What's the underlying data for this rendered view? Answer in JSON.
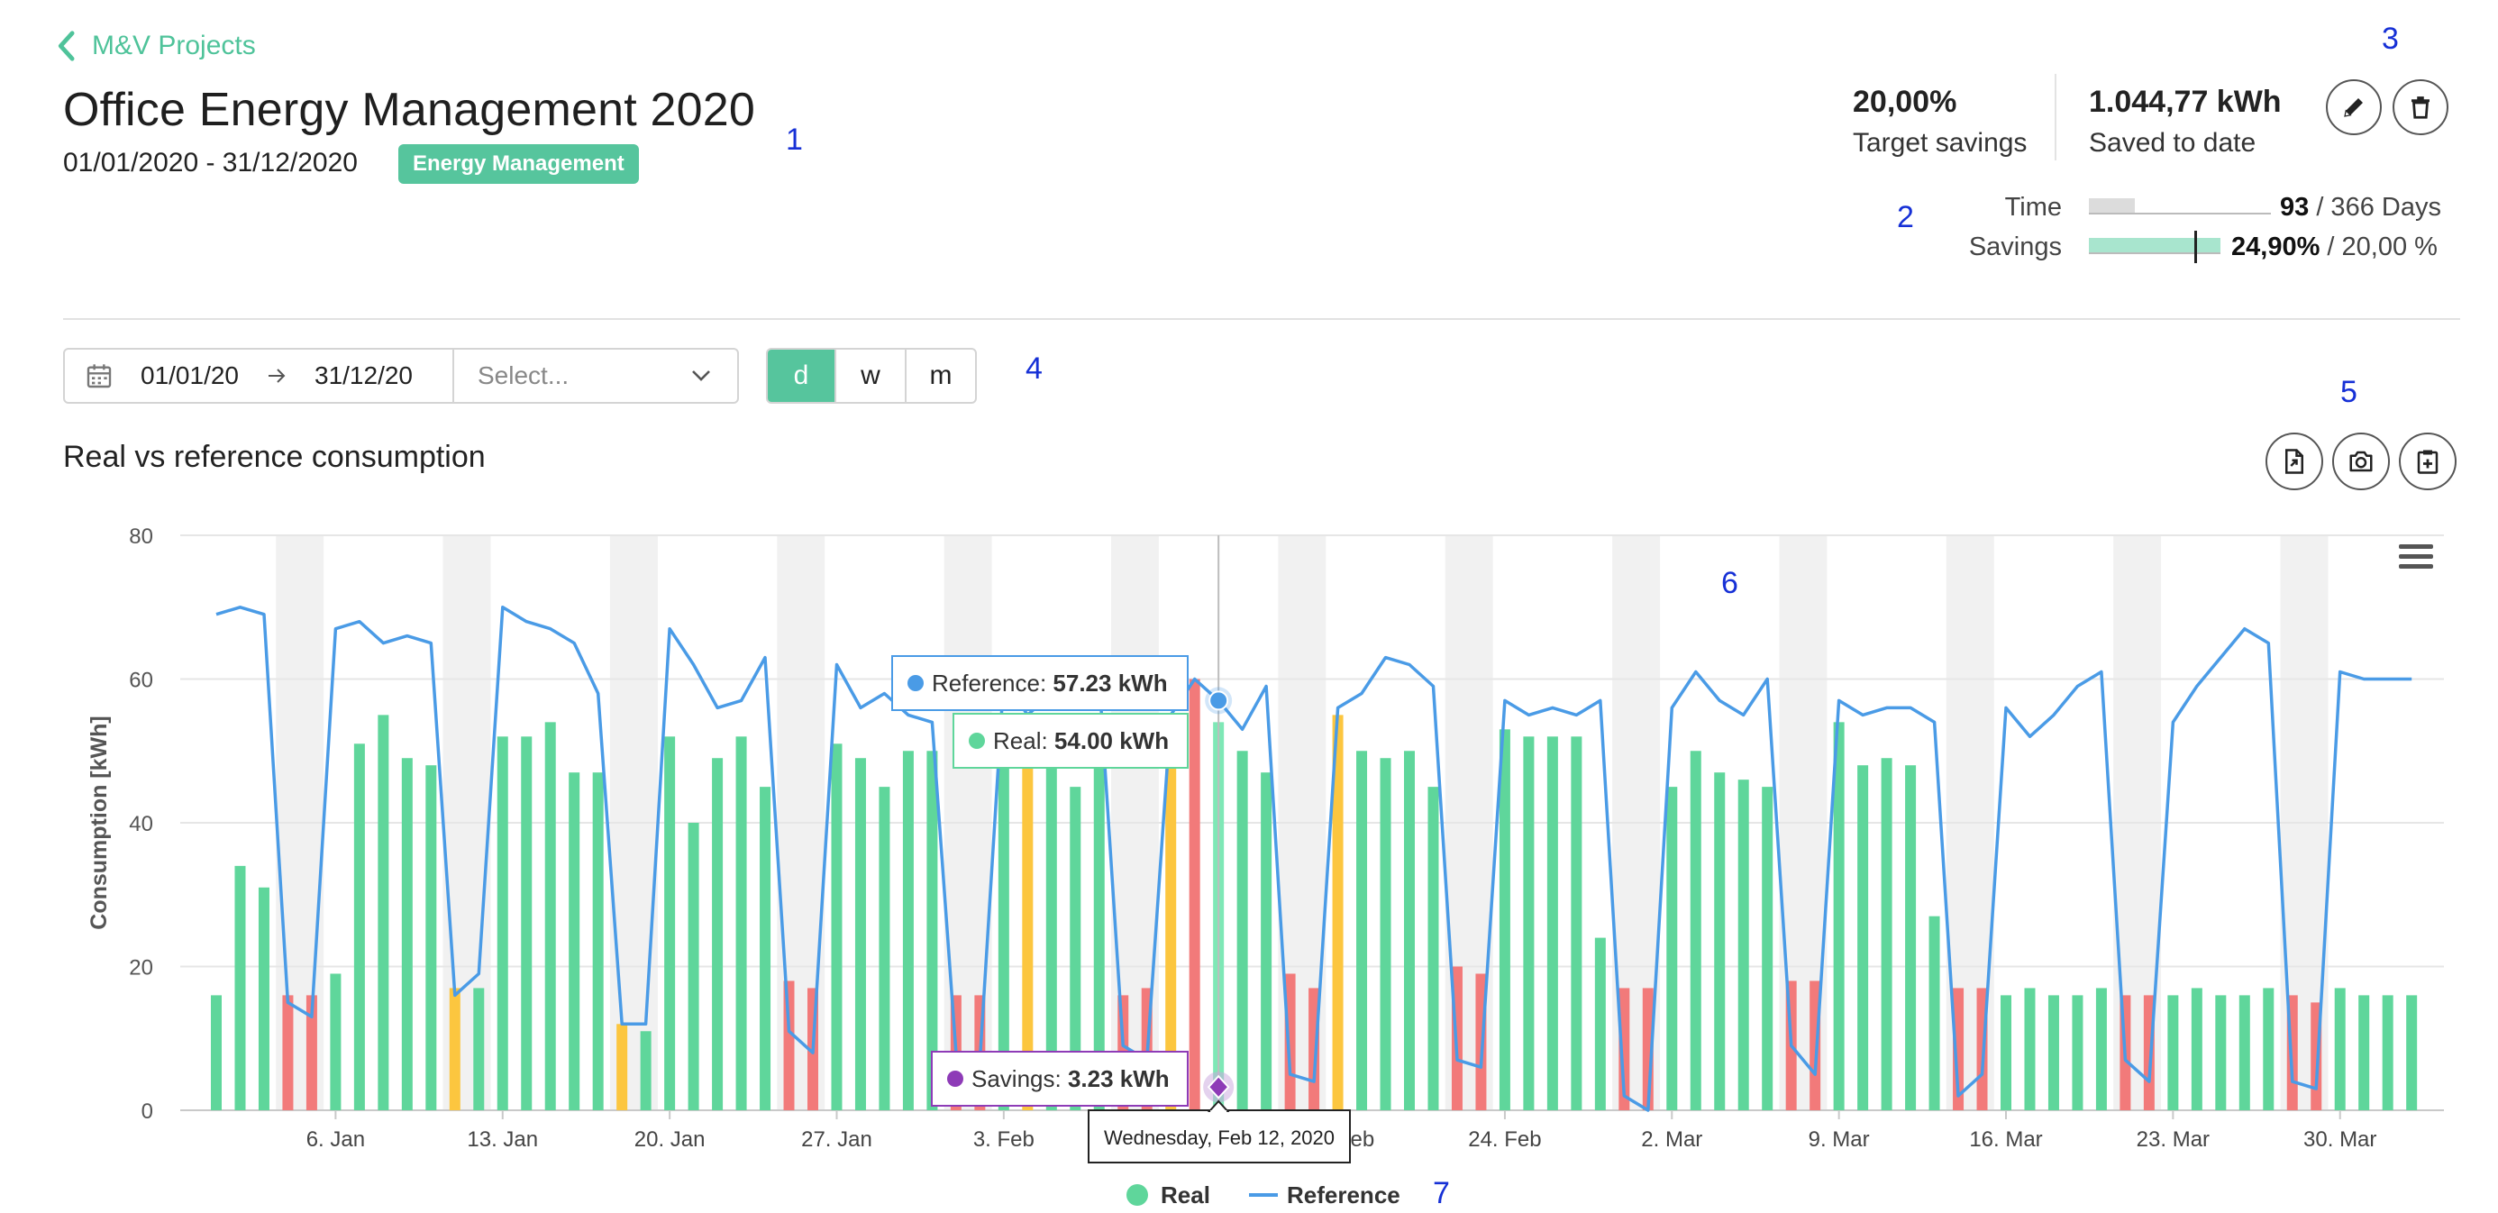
{
  "nav": {
    "back_label": "M&V Projects"
  },
  "project": {
    "title": "Office Energy Management 2020",
    "date_range": "01/01/2020 - 31/12/2020",
    "badge": "Energy Management"
  },
  "kpis": {
    "target_value": "20,00%",
    "target_label": "Target savings",
    "saved_value": "1.044,77 kWh",
    "saved_label": "Saved to date"
  },
  "progress": {
    "time_label": "Time",
    "time_value": "93",
    "time_suffix": " / 366 Days",
    "time_fraction": 0.254,
    "savings_label": "Savings",
    "savings_value": "24,90%",
    "savings_suffix": " / 20,00 %",
    "savings_fraction": 1.0,
    "savings_target_fraction": 0.8
  },
  "annotations": {
    "n1": "1",
    "n2": "2",
    "n3": "3",
    "n4": "4",
    "n5": "5",
    "n6": "6",
    "n7": "7"
  },
  "filters": {
    "start_date": "01/01/20",
    "end_date": "31/12/20",
    "select_placeholder": "Select...",
    "granularity": [
      "d",
      "w",
      "m"
    ],
    "granularity_selected": "d"
  },
  "chart_title": "Real vs reference consumption",
  "colors": {
    "accent": "#56c59d",
    "real_green": "#5fd69b",
    "real_red": "#f27a7a",
    "real_yellow": "#fcc63f",
    "reference_blue": "#4a9be6",
    "savings_purple": "#8e3bb7",
    "weekend_band": "#f1f1f1"
  },
  "chart_data": {
    "type": "bar",
    "ylabel": "Consumption [kWh]",
    "ylim": [
      0,
      80
    ],
    "y_ticks": [
      0,
      20,
      40,
      60,
      80
    ],
    "x_ticks": [
      "6. Jan",
      "13. Jan",
      "20. Jan",
      "27. Jan",
      "3. Feb",
      "10. Feb",
      "17. Feb",
      "24. Feb",
      "2. Mar",
      "9. Mar",
      "16. Mar",
      "23. Mar",
      "30. Mar"
    ],
    "x_start": "2020-01-01",
    "legend": [
      "Real",
      "Reference"
    ],
    "legend_position": "bottom-center",
    "series": [
      {
        "name": "Real",
        "values": [
          16,
          34,
          31,
          16,
          16,
          19,
          51,
          55,
          49,
          48,
          17,
          17,
          52,
          52,
          54,
          47,
          47,
          12,
          11,
          52,
          40,
          49,
          52,
          45,
          18,
          17,
          51,
          49,
          45,
          50,
          50,
          16,
          16,
          50,
          50,
          50,
          45,
          50,
          16,
          17,
          50,
          60,
          54,
          50,
          47,
          19,
          17,
          55,
          50,
          49,
          50,
          45,
          20,
          19,
          53,
          52,
          52,
          52,
          24,
          17,
          17,
          45,
          50,
          47,
          46,
          45,
          18,
          18,
          54,
          48,
          49,
          48,
          27,
          17,
          17,
          16,
          17,
          16,
          16,
          17,
          16,
          16,
          16,
          17,
          16,
          16,
          17,
          16,
          15,
          17,
          16,
          16,
          16
        ],
        "status": [
          "g",
          "g",
          "g",
          "r",
          "r",
          "g",
          "g",
          "g",
          "g",
          "g",
          "y",
          "g",
          "g",
          "g",
          "g",
          "g",
          "g",
          "y",
          "g",
          "g",
          "g",
          "g",
          "g",
          "g",
          "r",
          "r",
          "g",
          "g",
          "g",
          "g",
          "g",
          "r",
          "r",
          "g",
          "y",
          "g",
          "g",
          "g",
          "r",
          "r",
          "y",
          "r",
          "g",
          "g",
          "g",
          "r",
          "r",
          "y",
          "g",
          "g",
          "g",
          "g",
          "r",
          "r",
          "g",
          "g",
          "g",
          "g",
          "g",
          "r",
          "r",
          "g",
          "g",
          "g",
          "g",
          "g",
          "r",
          "r",
          "g",
          "g",
          "g",
          "g",
          "g",
          "r",
          "r",
          "g",
          "g",
          "g",
          "g",
          "g",
          "r",
          "r",
          "g",
          "g",
          "g",
          "g",
          "g",
          "r",
          "r",
          "g",
          "g",
          "g",
          "g"
        ]
      },
      {
        "name": "Reference",
        "values": [
          69,
          70,
          69,
          15,
          13,
          67,
          68,
          65,
          66,
          65,
          16,
          19,
          70,
          68,
          67,
          65,
          58,
          12,
          12,
          67,
          62,
          56,
          57,
          63,
          11,
          8,
          62,
          56,
          58,
          55,
          54,
          8,
          7,
          60,
          55,
          58,
          56,
          60,
          9,
          7,
          55,
          60,
          57,
          53,
          59,
          5,
          4,
          56,
          58,
          63,
          62,
          59,
          7,
          6,
          57,
          55,
          56,
          55,
          57,
          2,
          0,
          56,
          61,
          57,
          55,
          60,
          9,
          5,
          57,
          55,
          56,
          56,
          54,
          2,
          5,
          56,
          52,
          55,
          59,
          61,
          7,
          4,
          54,
          59,
          63,
          67,
          65,
          4,
          3,
          61,
          60,
          60,
          60
        ]
      }
    ],
    "highlight": {
      "date": "Wednesday, Feb 12, 2020",
      "reference_label": "Reference: ",
      "reference_value": "57.23 kWh",
      "real_label": "Real: ",
      "real_value": "54.00 kWh",
      "savings_label": "Savings: ",
      "savings_value": "3.23 kWh",
      "savings_amount": 3.23,
      "day_index": 42
    }
  }
}
